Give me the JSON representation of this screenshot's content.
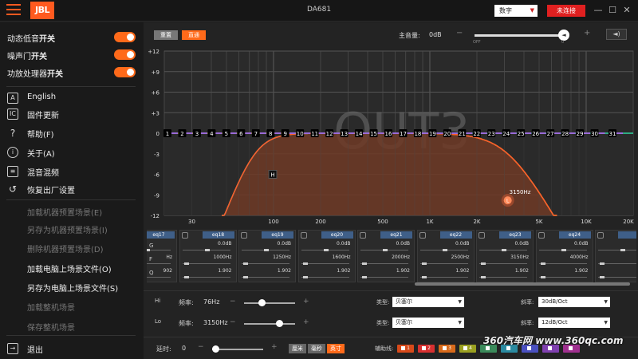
{
  "titlebar": {
    "logo": "JBL",
    "title": "DA681",
    "mode": "数字",
    "connect": "未连接",
    "minimize": "—",
    "maximize": "☐",
    "close": "✕"
  },
  "sidebar": {
    "toggles": [
      {
        "pre": "动态低音",
        "post": "开关",
        "on": true
      },
      {
        "pre": "噪声门",
        "post": "开关",
        "on": true
      },
      {
        "pre": "功放处理器",
        "post": "开关",
        "on": true
      }
    ],
    "menu": [
      {
        "icon": "A",
        "label": "English",
        "icon_name": "language-icon"
      },
      {
        "icon": "IC",
        "label": "固件更新",
        "icon_name": "chip-icon"
      },
      {
        "icon": "?",
        "label": "帮助(F)",
        "icon_name": "help-icon"
      },
      {
        "icon": "i",
        "label": "关于(A)",
        "icon_name": "info-icon"
      },
      {
        "icon": "≡",
        "label": "混音混频",
        "icon_name": "mixer-icon"
      },
      {
        "icon": "↺",
        "label": "恢复出厂设置",
        "icon_name": "restore-icon"
      }
    ],
    "scenes": [
      {
        "label": "加载机器预置场景(E)",
        "enabled": false
      },
      {
        "label": "另存为机器预置场景(I)",
        "enabled": false
      },
      {
        "label": "删除机器预置场景(D)",
        "enabled": false
      },
      {
        "label": "加载电脑上场景文件(O)",
        "enabled": true
      },
      {
        "label": "另存为电脑上场景文件(S)",
        "enabled": true
      },
      {
        "label": "加载整机场景",
        "enabled": false
      },
      {
        "label": "保存整机场景",
        "enabled": false
      }
    ],
    "exit": "退出"
  },
  "toolbar": {
    "reset": "重置",
    "direct": "直通",
    "master_label": "主音量:",
    "master_value": "0dB",
    "minus": "−",
    "plus": "+",
    "off": "OFF",
    "max": "0",
    "master_fraction": 1.0
  },
  "chart_data": {
    "type": "line",
    "channel_label": "OUT3",
    "y_ticks": [
      "+12",
      "+9",
      "+6",
      "+3",
      "0",
      "-3",
      "-6",
      "-9",
      "-12"
    ],
    "ylim": [
      -12,
      12
    ],
    "xlim": [
      20,
      20000
    ],
    "x_scale": "log",
    "x_ticks": [
      {
        "label": "30",
        "hz": 30
      },
      {
        "label": "100",
        "hz": 100
      },
      {
        "label": "200",
        "hz": 200
      },
      {
        "label": "500",
        "hz": 500
      },
      {
        "label": "1K",
        "hz": 1000
      },
      {
        "label": "2K",
        "hz": 2000
      },
      {
        "label": "5K",
        "hz": 5000
      },
      {
        "label": "10K",
        "hz": 10000
      },
      {
        "label": "20K",
        "hz": 20000
      }
    ],
    "eq_points": [
      "1",
      "2",
      "3",
      "4",
      "5",
      "6",
      "7",
      "8",
      "9",
      "10",
      "11",
      "12",
      "13",
      "14",
      "15",
      "16",
      "17",
      "18",
      "19",
      "20",
      "21",
      "22",
      "23",
      "24",
      "25",
      "26",
      "27",
      "28",
      "29",
      "30",
      "31"
    ],
    "highpass_hz": 76,
    "lowpass_hz": 3150,
    "h_marker": "H",
    "l_marker": "L",
    "l_freq_label": "3150Hz"
  },
  "bands": {
    "side_labels": [
      "G",
      "F",
      "Q"
    ],
    "items": [
      {
        "name": "eq17",
        "gain": "",
        "freq": "Hz",
        "q": "902"
      },
      {
        "name": "eq18",
        "gain": "0.0dB",
        "freq": "1000Hz",
        "q": "1.902"
      },
      {
        "name": "eq19",
        "gain": "0.0dB",
        "freq": "1250Hz",
        "q": "1.902"
      },
      {
        "name": "eq20",
        "gain": "0.0dB",
        "freq": "1600Hz",
        "q": "1.902"
      },
      {
        "name": "eq21",
        "gain": "0.0dB",
        "freq": "2000Hz",
        "q": "1.902"
      },
      {
        "name": "eq22",
        "gain": "0.0dB",
        "freq": "2500Hz",
        "q": "1.902"
      },
      {
        "name": "eq23",
        "gain": "0.0dB",
        "freq": "3150Hz",
        "q": "1.902"
      },
      {
        "name": "eq24",
        "gain": "0.0dB",
        "freq": "4000Hz",
        "q": "1.902"
      },
      {
        "name": "",
        "gain": "0.",
        "freq": "50",
        "q": "1."
      }
    ]
  },
  "crossover": {
    "hi": {
      "icon": "Hi",
      "freq_label": "频率:",
      "freq": "76Hz",
      "type_label": "类型:",
      "type": "贝塞尔",
      "slope_label": "斜率:",
      "slope": "30dB/Oct",
      "fraction": 0.35
    },
    "lo": {
      "icon": "Lo",
      "freq_label": "频率:",
      "freq": "3150Hz",
      "type_label": "类型:",
      "type": "贝塞尔",
      "slope_label": "斜率:",
      "slope": "12dB/Oct",
      "fraction": 0.68
    },
    "minus": "−",
    "plus": "+"
  },
  "bottom": {
    "delay_label": "延时:",
    "delay_value": "0",
    "minus": "−",
    "plus": "+",
    "units": [
      "厘米",
      "毫秒",
      "英寸"
    ],
    "aux_label": "辅助线:",
    "aux": [
      {
        "label": "1",
        "color": "#d84a1a"
      },
      {
        "label": "2",
        "color": "#d83030"
      },
      {
        "label": "3",
        "color": "#d86a1a"
      },
      {
        "label": "4",
        "color": "#9aa020"
      },
      {
        "label": "",
        "color": "#3a8a5a"
      },
      {
        "label": "",
        "color": "#2a8aa0"
      },
      {
        "label": "",
        "color": "#4a50c0"
      },
      {
        "label": "",
        "color": "#8040b0"
      },
      {
        "label": "",
        "color": "#a03090"
      }
    ]
  },
  "watermark": "360汽车网 www.360qc.com",
  "colors": {
    "accent": "#ff6a1a",
    "connect": "#e02020",
    "hp_curve": "#2fd6a0",
    "lp_curve": "#e8d830",
    "sum_curve": "#ff5a2a",
    "eq_point": "#9a6ad8",
    "fill": "#6e3a26"
  }
}
